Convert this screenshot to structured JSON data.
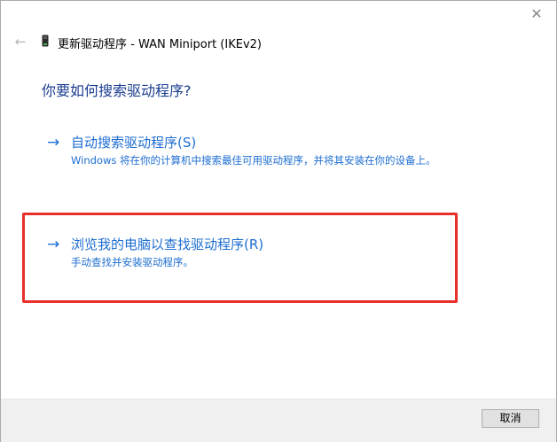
{
  "window": {
    "title": "更新驱动程序 - WAN Miniport (IKEv2)",
    "close_icon": "close-icon",
    "back_icon": "back-arrow-icon",
    "device_icon": "network-adapter-icon"
  },
  "main": {
    "heading": "你要如何搜索驱动程序?",
    "options": [
      {
        "arrow": "→",
        "title": "自动搜索驱动程序(S)",
        "description": "Windows 将在你的计算机中搜索最佳可用驱动程序，并将其安装在你的设备上。"
      },
      {
        "arrow": "→",
        "title": "浏览我的电脑以查找驱动程序(R)",
        "description": "手动查找并安装驱动程序。"
      }
    ]
  },
  "footer": {
    "cancel_label": "取消"
  },
  "colors": {
    "link_blue": "#1d6dd1",
    "heading_blue": "#1a3d8f",
    "highlight_red": "#e8302a",
    "footer_bg": "#f0f0f0"
  }
}
